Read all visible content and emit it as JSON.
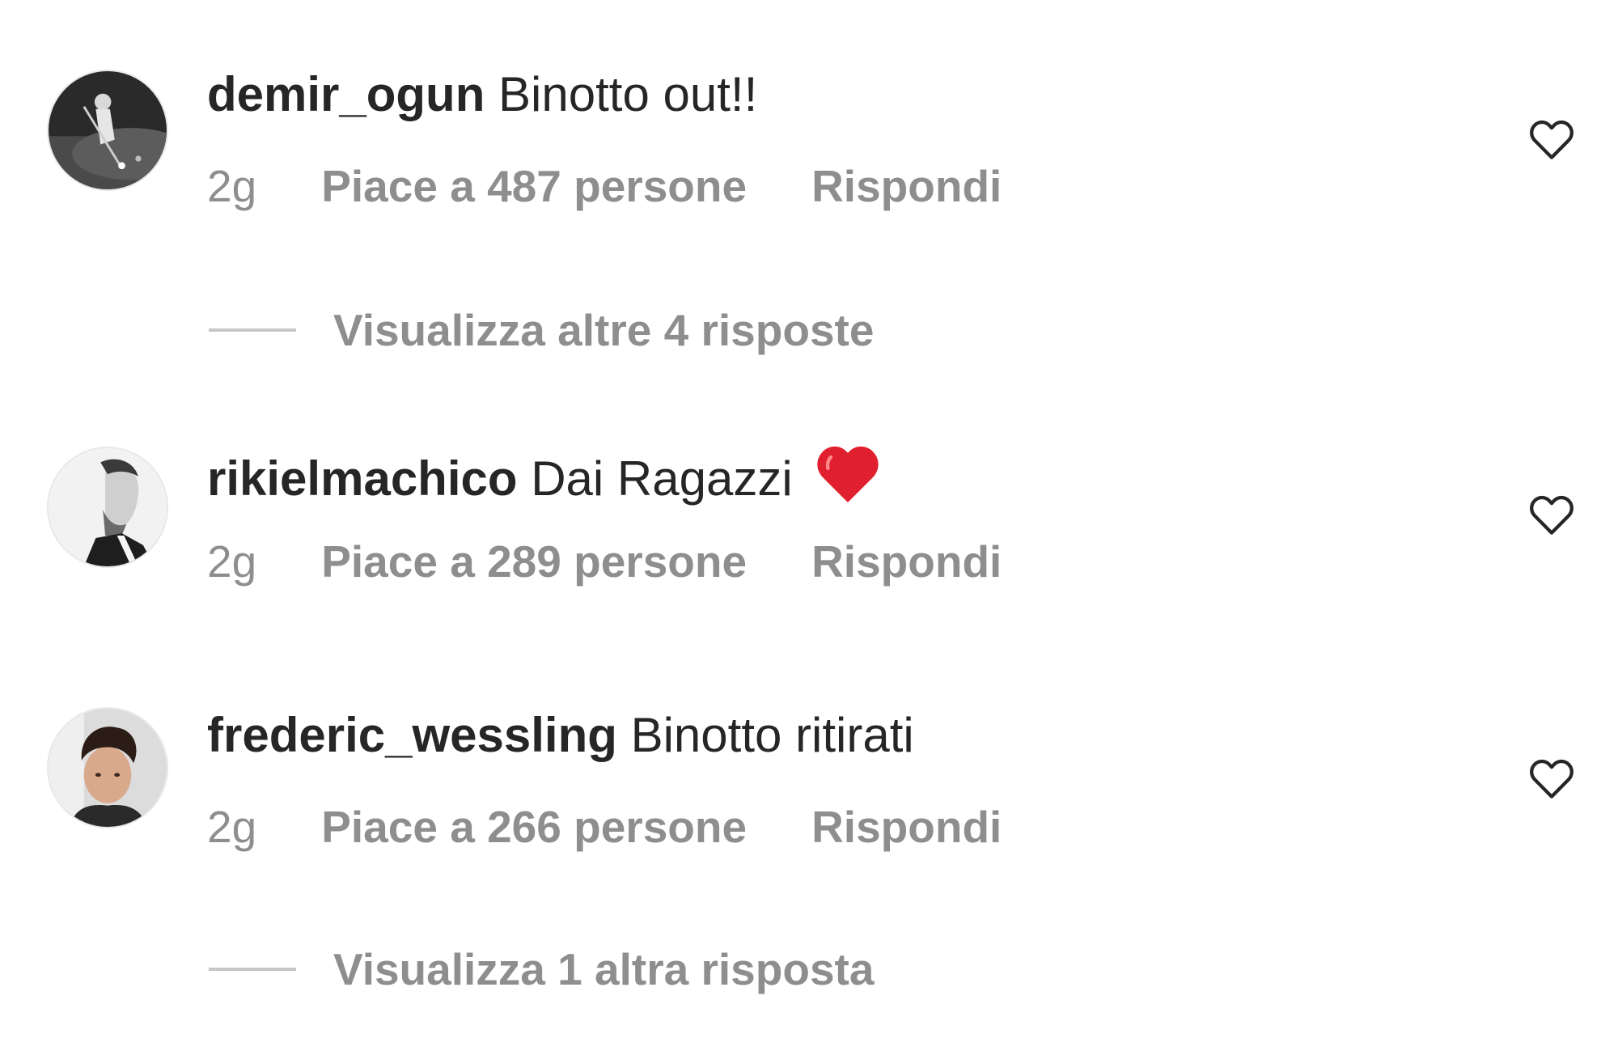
{
  "comments": [
    {
      "username": "demir_ogun",
      "text": "Binotto out!!",
      "time": "2g",
      "likes": "Piace a 487 persone",
      "reply": "Rispondi",
      "avatar": "billiards-player-avatar",
      "view_replies": "Visualizza altre 4 risposte"
    },
    {
      "username": "rikielmachico",
      "text": "Dai Ragazzi",
      "emoji": "red-heart-emoji",
      "time": "2g",
      "likes": "Piace a 289 persone",
      "reply": "Rispondi",
      "avatar": "profile-side-portrait-avatar"
    },
    {
      "username": "frederic_wessling",
      "text": "Binotto ritirati",
      "time": "2g",
      "likes": "Piace a 266 persone",
      "reply": "Rispondi",
      "avatar": "face-selfie-avatar",
      "view_replies": "Visualizza 1 altra risposta"
    }
  ],
  "icons": {
    "like": "heart-outline-icon"
  },
  "colors": {
    "text_primary": "#262626",
    "text_secondary": "#8e8e8e",
    "divider": "#c7c7c7",
    "emoji_heart": "#e0202e"
  }
}
